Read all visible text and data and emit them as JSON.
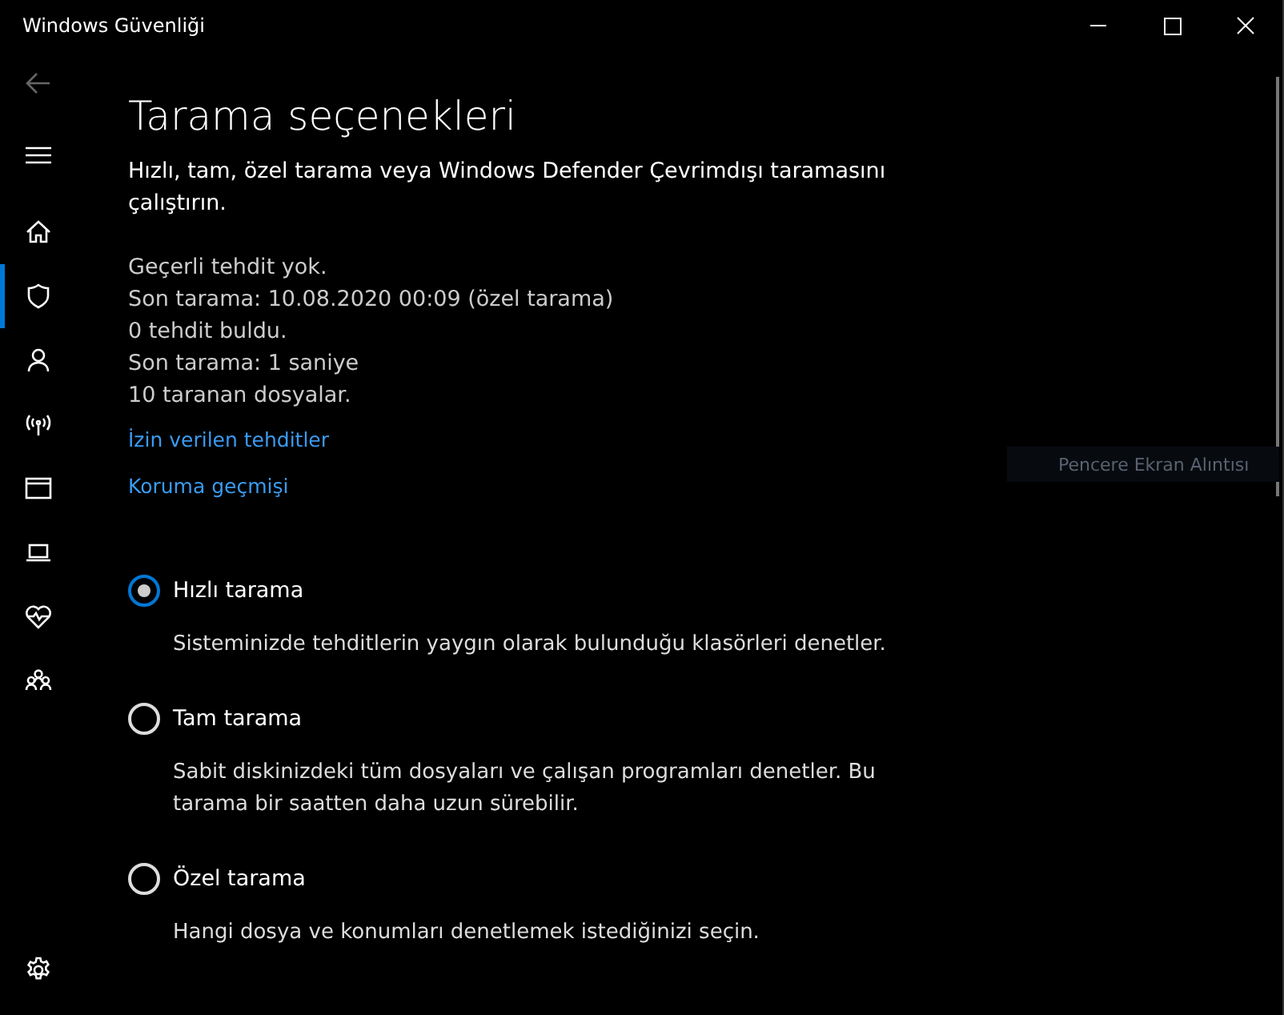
{
  "window": {
    "title": "Windows Güvenliği"
  },
  "sidebar": {
    "items": [
      {
        "kind": "home",
        "selected": false
      },
      {
        "kind": "shield",
        "selected": true
      },
      {
        "kind": "person",
        "selected": false
      },
      {
        "kind": "antenna",
        "selected": false
      },
      {
        "kind": "browser",
        "selected": false
      },
      {
        "kind": "laptop",
        "selected": false
      },
      {
        "kind": "heart",
        "selected": false
      },
      {
        "kind": "family",
        "selected": false
      }
    ]
  },
  "page": {
    "title": "Tarama seçenekleri",
    "description": "Hızlı, tam, özel tarama veya Windows Defender Çevrimdışı taramasını çalıştırın.",
    "status_lines": [
      "Geçerli tehdit yok.",
      "Son tarama: 10.08.2020 00:09 (özel tarama)",
      "0 tehdit buldu.",
      "Son tarama: 1 saniye",
      "10 taranan dosyalar."
    ],
    "links": [
      "İzin verilen tehditler",
      "Koruma geçmişi"
    ],
    "options": [
      {
        "label": "Hızlı tarama",
        "description": "Sisteminizde tehditlerin yaygın olarak bulunduğu klasörleri denetler.",
        "selected": true
      },
      {
        "label": "Tam tarama",
        "description": "Sabit diskinizdeki tüm dosyaları ve çalışan programları denetler. Bu tarama bir saatten daha uzun sürebilir.",
        "selected": false
      },
      {
        "label": "Özel tarama",
        "description": "Hangi dosya ve konumları denetlemek istediğinizi seçin.",
        "selected": false
      }
    ]
  },
  "overlay": {
    "text": "Pencere Ekran Alıntısı"
  }
}
